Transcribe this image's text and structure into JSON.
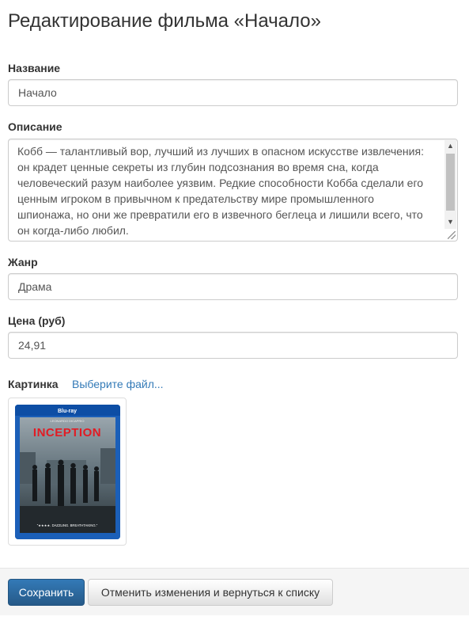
{
  "page": {
    "title": "Редактирование фильма «Начало»"
  },
  "form": {
    "name_label": "Название",
    "name_value": "Начало",
    "description_label": "Описание",
    "description_lines": [
      "Кобб — талантливый вор, лучший из лучших в опасном искусстве извлечения:",
      "он крадет ценные секреты из глубин подсознания во время сна, когда",
      "человеческий разум наиболее уязвим. Редкие способности Кобба сделали его",
      "ценным игроком в привычном к предательству мире промышленного",
      "шпионажа, но они же превратили его в извечного беглеца и лишили всего, что",
      "он когда-либо любил."
    ],
    "genre_label": "Жанр",
    "genre_value": "Драма",
    "price_label": "Цена (руб)",
    "price_value": "24,91",
    "image_label": "Картинка",
    "choose_file_link": "Выберите файл..."
  },
  "poster": {
    "top_text": "LEONARDO DICAPRIO",
    "title": "INCEPTION",
    "tagline": "\"★★★★. DAZZLING. BREATHTAKING.\"",
    "brand": "Blu-ray",
    "case_color": "#1b5fb8",
    "title_color": "#e21b23"
  },
  "actions": {
    "save_label": "Сохранить",
    "cancel_label": "Отменить изменения и вернуться к списку"
  },
  "colors": {
    "primary": "#337ab7",
    "link": "#337ab7",
    "footer_bg": "#f5f5f5"
  }
}
